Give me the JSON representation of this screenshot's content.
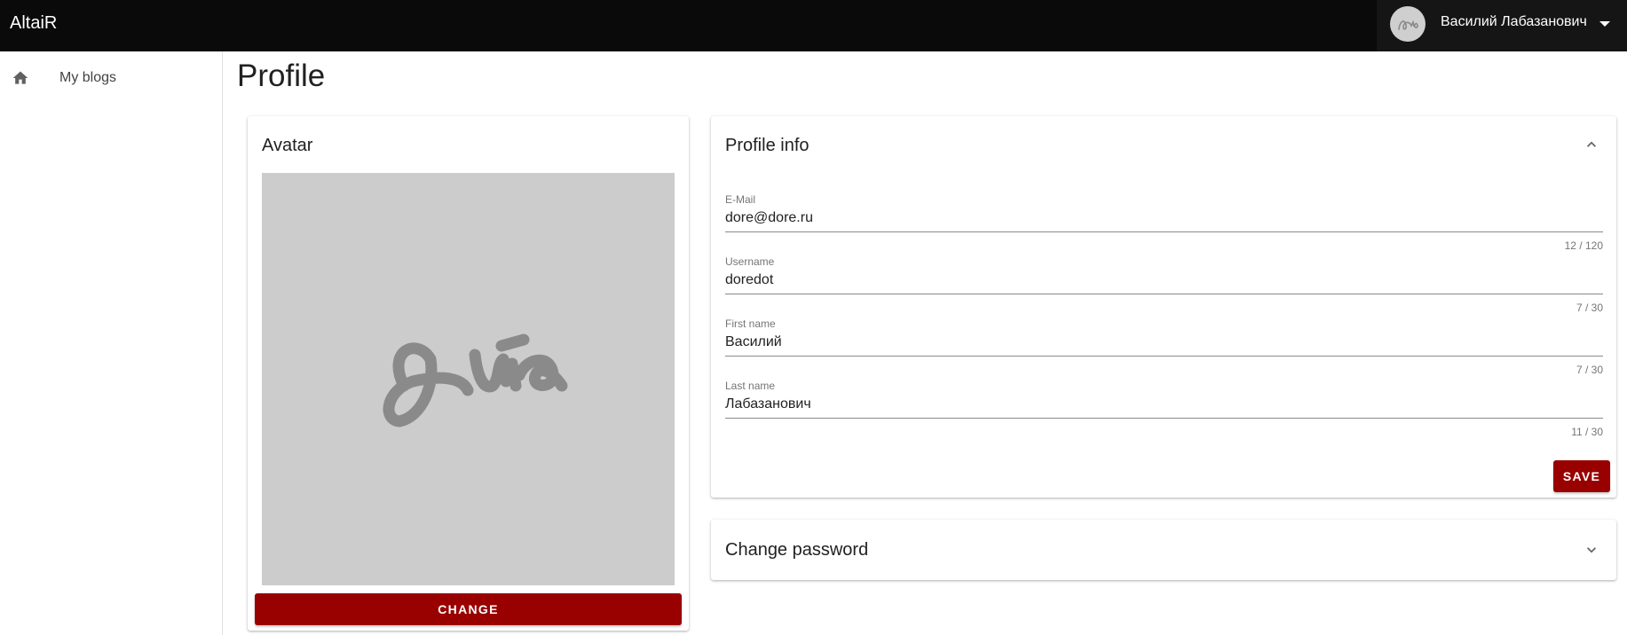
{
  "app": {
    "title": "AltaiR"
  },
  "user": {
    "name": "Василий Лабазанович",
    "avatar_icon": "signature-avatar-icon",
    "menu_icon": "caret-down-icon"
  },
  "sidebar": {
    "items": [
      {
        "label": "My blogs",
        "icon": "home-icon"
      }
    ]
  },
  "page": {
    "title": "Profile"
  },
  "avatar_card": {
    "title": "Avatar",
    "change_label": "CHANGE"
  },
  "profile_info": {
    "title": "Profile info",
    "expanded": true,
    "fields": [
      {
        "label": "E-Mail",
        "value": "dore@dore.ru",
        "counter": "12 / 120"
      },
      {
        "label": "Username",
        "value": "doredot",
        "counter": "7 / 30"
      },
      {
        "label": "First name",
        "value": "Василий",
        "counter": "7 / 30"
      },
      {
        "label": "Last name",
        "value": "Лабазанович",
        "counter": "11 / 30"
      }
    ],
    "save_label": "SAVE"
  },
  "change_password": {
    "title": "Change password",
    "expanded": false
  },
  "colors": {
    "topbar": "#0a0a0a",
    "accent": "#990000",
    "avatar_bg": "#cccccc",
    "signature": "#8a8a8a"
  }
}
